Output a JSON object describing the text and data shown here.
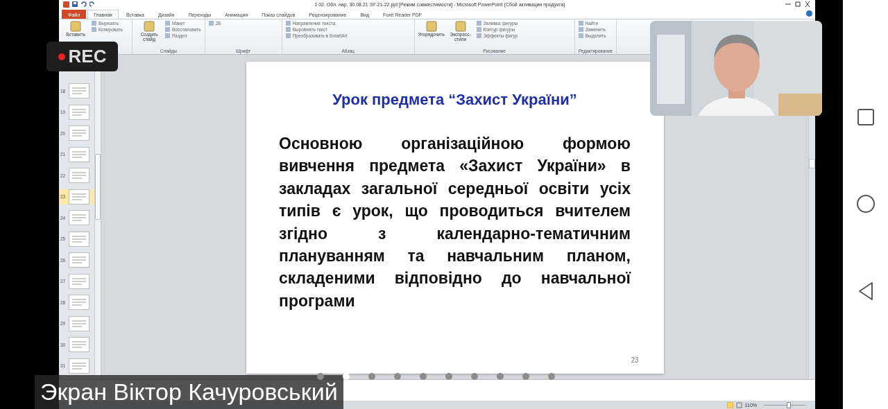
{
  "window": {
    "title": "1 02. Обл. нар. 30.08.21 ЗУ-21-22.ppt [Режим совместимости]  -  Microsoft PowerPoint (Сбой активации продукта)"
  },
  "tabs": [
    {
      "label": "Файл",
      "kind": "file",
      "selected": false
    },
    {
      "label": "Главная",
      "kind": "tab",
      "selected": true
    },
    {
      "label": "Вставка",
      "kind": "tab",
      "selected": false
    },
    {
      "label": "Дизайн",
      "kind": "tab",
      "selected": false
    },
    {
      "label": "Переходы",
      "kind": "tab",
      "selected": false
    },
    {
      "label": "Анимация",
      "kind": "tab",
      "selected": false
    },
    {
      "label": "Показ слайдов",
      "kind": "tab",
      "selected": false
    },
    {
      "label": "Рецензирование",
      "kind": "tab",
      "selected": false
    },
    {
      "label": "Вид",
      "kind": "tab",
      "selected": false
    },
    {
      "label": "Foxit Reader PDF",
      "kind": "tab",
      "selected": false
    }
  ],
  "ribbon": {
    "groups": [
      {
        "big": [
          "Вставить"
        ],
        "items": [
          "Вырезать",
          "Копировать"
        ]
      },
      {
        "label": "Слайды",
        "big": [
          "Создать слайд"
        ],
        "items": [
          "Макет",
          "Восстановить",
          "Раздел"
        ]
      },
      {
        "label": "Шрифт",
        "items": [
          "28"
        ]
      },
      {
        "label": "Абзац",
        "items": [
          "Направление текста",
          "Выровнять текст",
          "Преобразовать в SmartArt"
        ]
      },
      {
        "label": "Рисование",
        "big": [
          "Упорядочить",
          "Экспресс-стили"
        ],
        "items": [
          "Заливка фигуры",
          "Контур фигуры",
          "Эффекты фигур"
        ]
      },
      {
        "label": "Редактирование",
        "items": [
          "Найти",
          "Заменить",
          "Выделить"
        ]
      }
    ]
  },
  "thumbnails": [
    {
      "number": "18",
      "selected": false
    },
    {
      "number": "19",
      "selected": false
    },
    {
      "number": "20",
      "selected": false
    },
    {
      "number": "21",
      "selected": false
    },
    {
      "number": "22",
      "selected": false
    },
    {
      "number": "23",
      "selected": true
    },
    {
      "number": "24",
      "selected": false
    },
    {
      "number": "25",
      "selected": false
    },
    {
      "number": "26",
      "selected": false
    },
    {
      "number": "27",
      "selected": false
    },
    {
      "number": "28",
      "selected": false
    },
    {
      "number": "29",
      "selected": false
    },
    {
      "number": "30",
      "selected": false
    },
    {
      "number": "31",
      "selected": false
    }
  ],
  "slide": {
    "title": "Урок предмета “Захист України”",
    "body": "Основною організаційною формою вивчення предмета «Захист України» в закладах загальної середньої освіти усіх типів є урок, що проводиться вчителем згідно з календарно-тематичним плануванням та навчальним планом, складеними відповідно до навчальної програми",
    "page_number": "23"
  },
  "status_bar": {
    "zoom": "110%",
    "zoom_slider": {
      "level": 0.6
    }
  },
  "recording": {
    "label": "REC"
  },
  "caption": "Экран Віктор Качуровський",
  "pages": [
    {
      "selected": false
    },
    {
      "selected": true
    },
    {
      "selected": false
    },
    {
      "selected": false
    },
    {
      "selected": false
    },
    {
      "selected": false
    },
    {
      "selected": false
    },
    {
      "selected": false
    },
    {
      "selected": false
    },
    {
      "selected": false
    }
  ]
}
